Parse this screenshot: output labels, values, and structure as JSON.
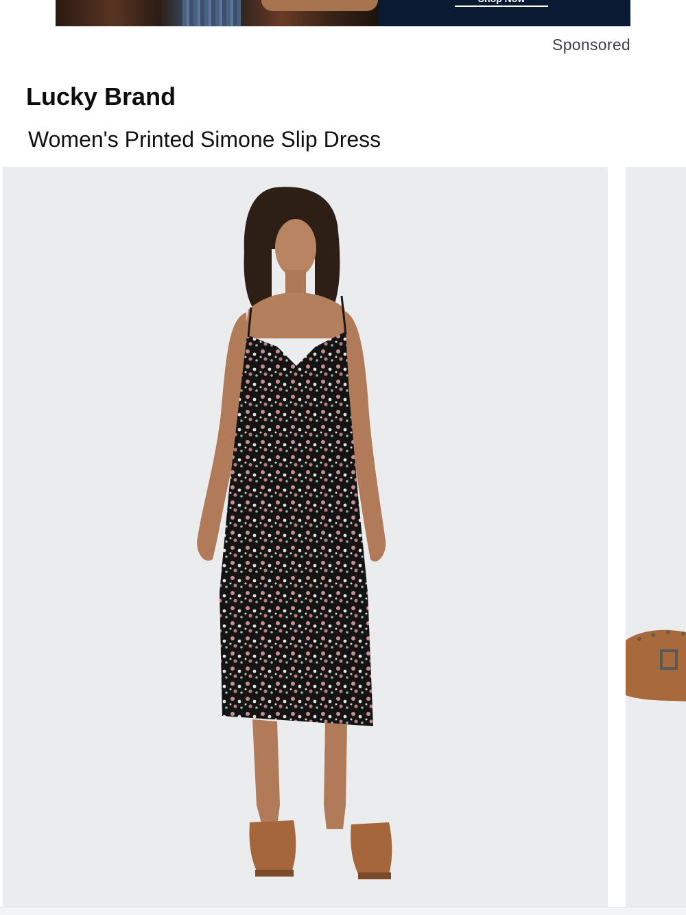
{
  "ad": {
    "cta_label": "Shop Now",
    "sponsored_label": "Sponsored",
    "panel_color": "#0b1a33"
  },
  "product": {
    "brand": "Lucky Brand",
    "title": "Women's Printed Simone Slip Dress"
  },
  "gallery": {
    "images": [
      {
        "alt": "Model wearing black floral printed slip midi dress with brown clogs"
      },
      {
        "alt": "Close-up of brown studded clog shoe"
      }
    ],
    "background_color": "#ebecee"
  }
}
